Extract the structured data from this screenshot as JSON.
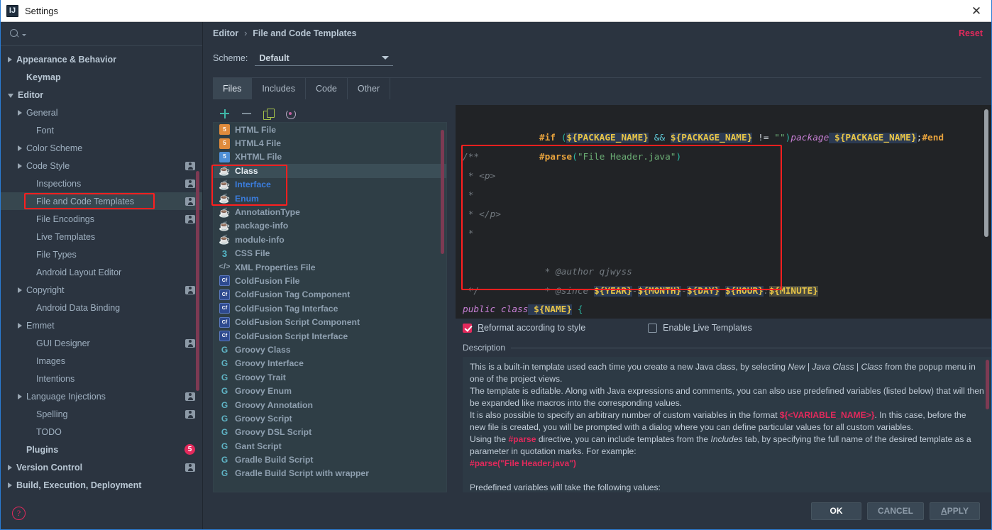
{
  "window": {
    "title": "Settings",
    "app_icon": "IJ",
    "close_icon": "✕"
  },
  "sidebar": {
    "search": {
      "placeholder": "",
      "value": "",
      "icon": "search-icon"
    },
    "items": [
      {
        "label": "Appearance & Behavior",
        "arrow": "right",
        "bold": true,
        "indent": 0,
        "badge": ""
      },
      {
        "label": "Keymap",
        "arrow": "none",
        "bold": true,
        "indent": 1,
        "badge": ""
      },
      {
        "label": "Editor",
        "arrow": "down",
        "bold": true,
        "indent": 0,
        "badge": ""
      },
      {
        "label": "General",
        "arrow": "right",
        "bold": false,
        "indent": 1,
        "badge": ""
      },
      {
        "label": "Font",
        "arrow": "none",
        "bold": false,
        "indent": 2,
        "badge": ""
      },
      {
        "label": "Color Scheme",
        "arrow": "right",
        "bold": false,
        "indent": 1,
        "badge": ""
      },
      {
        "label": "Code Style",
        "arrow": "right",
        "bold": false,
        "indent": 1,
        "badge": "user"
      },
      {
        "label": "Inspections",
        "arrow": "none",
        "bold": false,
        "indent": 2,
        "badge": "user"
      },
      {
        "label": "File and Code Templates",
        "arrow": "none",
        "bold": false,
        "indent": 2,
        "badge": "user",
        "selected": true,
        "highlighted": true
      },
      {
        "label": "File Encodings",
        "arrow": "none",
        "bold": false,
        "indent": 2,
        "badge": "user"
      },
      {
        "label": "Live Templates",
        "arrow": "none",
        "bold": false,
        "indent": 2,
        "badge": ""
      },
      {
        "label": "File Types",
        "arrow": "none",
        "bold": false,
        "indent": 2,
        "badge": ""
      },
      {
        "label": "Android Layout Editor",
        "arrow": "none",
        "bold": false,
        "indent": 2,
        "badge": ""
      },
      {
        "label": "Copyright",
        "arrow": "right",
        "bold": false,
        "indent": 1,
        "badge": "user"
      },
      {
        "label": "Android Data Binding",
        "arrow": "none",
        "bold": false,
        "indent": 2,
        "badge": ""
      },
      {
        "label": "Emmet",
        "arrow": "right",
        "bold": false,
        "indent": 1,
        "badge": ""
      },
      {
        "label": "GUI Designer",
        "arrow": "none",
        "bold": false,
        "indent": 2,
        "badge": "user"
      },
      {
        "label": "Images",
        "arrow": "none",
        "bold": false,
        "indent": 2,
        "badge": ""
      },
      {
        "label": "Intentions",
        "arrow": "none",
        "bold": false,
        "indent": 2,
        "badge": ""
      },
      {
        "label": "Language Injections",
        "arrow": "right",
        "bold": false,
        "indent": 1,
        "badge": "user"
      },
      {
        "label": "Spelling",
        "arrow": "none",
        "bold": false,
        "indent": 2,
        "badge": "user"
      },
      {
        "label": "TODO",
        "arrow": "none",
        "bold": false,
        "indent": 2,
        "badge": ""
      },
      {
        "label": "Plugins",
        "arrow": "none",
        "bold": true,
        "indent": 1,
        "badge": "5"
      },
      {
        "label": "Version Control",
        "arrow": "right",
        "bold": true,
        "indent": 0,
        "badge": "user"
      },
      {
        "label": "Build, Execution, Deployment",
        "arrow": "right",
        "bold": true,
        "indent": 0,
        "badge": ""
      }
    ],
    "help_icon": "?"
  },
  "header": {
    "breadcrumb": [
      "Editor",
      "File and Code Templates"
    ],
    "separator": "›",
    "reset_label": "Reset",
    "scheme_label": "Scheme:",
    "scheme_value": "Default"
  },
  "tabs": [
    {
      "label": "Files",
      "active": true
    },
    {
      "label": "Includes",
      "active": false
    },
    {
      "label": "Code",
      "active": false
    },
    {
      "label": "Other",
      "active": false
    }
  ],
  "templates": {
    "toolbar": [
      {
        "name": "add-icon",
        "title": "+"
      },
      {
        "name": "remove-icon",
        "title": "−"
      },
      {
        "name": "copy-icon",
        "title": "copy"
      },
      {
        "name": "reset-icon",
        "title": "reset"
      }
    ],
    "items": [
      {
        "label": "HTML File",
        "icon": "html",
        "icon_text": "5",
        "state": "normal"
      },
      {
        "label": "HTML4 File",
        "icon": "html",
        "icon_text": "5",
        "state": "normal"
      },
      {
        "label": "XHTML File",
        "icon": "xhtml",
        "icon_text": "5",
        "state": "normal"
      },
      {
        "label": "Class",
        "icon": "java",
        "icon_text": "☕",
        "state": "selected"
      },
      {
        "label": "Interface",
        "icon": "java",
        "icon_text": "☕",
        "state": "modified"
      },
      {
        "label": "Enum",
        "icon": "java",
        "icon_text": "☕",
        "state": "modified"
      },
      {
        "label": "AnnotationType",
        "icon": "java",
        "icon_text": "☕",
        "state": "normal"
      },
      {
        "label": "package-info",
        "icon": "java",
        "icon_text": "☕",
        "state": "normal"
      },
      {
        "label": "module-info",
        "icon": "java",
        "icon_text": "☕",
        "state": "normal"
      },
      {
        "label": "CSS File",
        "icon": "css",
        "icon_text": "3",
        "state": "normal"
      },
      {
        "label": "XML Properties File",
        "icon": "xml",
        "icon_text": "</>",
        "state": "normal"
      },
      {
        "label": "ColdFusion File",
        "icon": "cf",
        "icon_text": "Cf",
        "state": "normal"
      },
      {
        "label": "ColdFusion Tag Component",
        "icon": "cf",
        "icon_text": "Cf",
        "state": "normal"
      },
      {
        "label": "ColdFusion Tag Interface",
        "icon": "cf",
        "icon_text": "Cf",
        "state": "normal"
      },
      {
        "label": "ColdFusion Script Component",
        "icon": "cf",
        "icon_text": "Cf",
        "state": "normal"
      },
      {
        "label": "ColdFusion Script Interface",
        "icon": "cf",
        "icon_text": "Cf",
        "state": "normal"
      },
      {
        "label": "Groovy Class",
        "icon": "groovy",
        "icon_text": "G",
        "state": "normal"
      },
      {
        "label": "Groovy Interface",
        "icon": "groovy",
        "icon_text": "G",
        "state": "normal"
      },
      {
        "label": "Groovy Trait",
        "icon": "groovy",
        "icon_text": "G",
        "state": "normal"
      },
      {
        "label": "Groovy Enum",
        "icon": "groovy",
        "icon_text": "G",
        "state": "normal"
      },
      {
        "label": "Groovy Annotation",
        "icon": "groovy",
        "icon_text": "G",
        "state": "normal"
      },
      {
        "label": "Groovy Script",
        "icon": "groovy",
        "icon_text": "G",
        "state": "normal"
      },
      {
        "label": "Groovy DSL Script",
        "icon": "groovy",
        "icon_text": "G",
        "state": "normal"
      },
      {
        "label": "Gant Script",
        "icon": "groovy",
        "icon_text": "G",
        "state": "normal"
      },
      {
        "label": "Gradle Build Script",
        "icon": "groovy",
        "icon_text": "G",
        "state": "normal"
      },
      {
        "label": "Gradle Build Script with wrapper",
        "icon": "groovy",
        "icon_text": "G",
        "state": "normal"
      }
    ]
  },
  "editor": {
    "line1": {
      "directive_if": "#if",
      "open_paren": " (",
      "var1": "${PACKAGE_NAME}",
      "and": " && ",
      "var2": "${PACKAGE_NAME}",
      "neq": " != ",
      "empty_string": "\"\"",
      "close_paren": ")",
      "package_kw": "package",
      "var3": " ${PACKAGE_NAME}",
      "semicolon": ";",
      "directive_end": "#end"
    },
    "line2": {
      "directive_parse": "#parse",
      "open": "(",
      "arg": "\"File Header.java\"",
      "close": ")"
    },
    "comment_lines": [
      "/**",
      " * <p>",
      " *",
      " * </p>",
      " *"
    ],
    "author_line": {
      "star": " * ",
      "tag": "@author",
      "value": " qjwyss"
    },
    "since_line": {
      "star": " * ",
      "tag": "@since",
      "space": " ",
      "year": "${YEAR}",
      "d1": "-",
      "month": "${MONTH}",
      "d2": "-",
      "day": "${DAY}",
      "sp": " ",
      "hour": "${HOUR}",
      "colon": ":",
      "minute": "${MINUTE}"
    },
    "comment_close": " */",
    "class_line": {
      "modifier": "public class",
      "name": " ${NAME}",
      "brace": " {"
    }
  },
  "options": {
    "reformat": {
      "label": "Reformat according to style",
      "checked": true,
      "mnemonic": "R"
    },
    "live_templates": {
      "label": "Enable Live Templates",
      "checked": false,
      "mnemonic": "L"
    }
  },
  "description": {
    "legend": "Description",
    "p1_a": "This is a built-in template used each time you create a new Java class, by selecting ",
    "p1_new": "New",
    "p1_sep1": " | ",
    "p1_javaclass": "Java Class",
    "p1_sep2": " | ",
    "p1_class": "Class",
    "p1_b": " from the popup menu in one of the project views.",
    "p2": "The template is editable. Along with Java expressions and comments, you can also use predefined variables (listed below) that will then be expanded like macros into the corresponding values.",
    "p3_a": "It is also possible to specify an arbitrary number of custom variables in the format ",
    "p3_var": "${<VARIABLE_NAME>}",
    "p3_b": ". In this case, before the new file is created, you will be prompted with a dialog where you can define particular values for all custom variables.",
    "p4_a": "Using the ",
    "p4_parse": "#parse",
    "p4_b": " directive, you can include templates from the ",
    "p4_includes": "Includes",
    "p4_c": " tab, by specifying the full name of the desired template as a parameter in quotation marks. For example:",
    "p5_code": "#parse(\"File Header.java\")",
    "p6": "Predefined variables will take the following values:"
  },
  "footer": {
    "ok": "OK",
    "cancel": "CANCEL",
    "apply": "APPLY",
    "apply_mnemonic": "A"
  },
  "colors": {
    "accent_pink": "#e3295c",
    "highlight_red": "#ff1f1f",
    "window_border": "#2a7cd4",
    "panel_bg": "#2b3440",
    "editor_bg": "#212326",
    "selection": "#3b4e57",
    "modified_blue": "#3b7ddd"
  }
}
